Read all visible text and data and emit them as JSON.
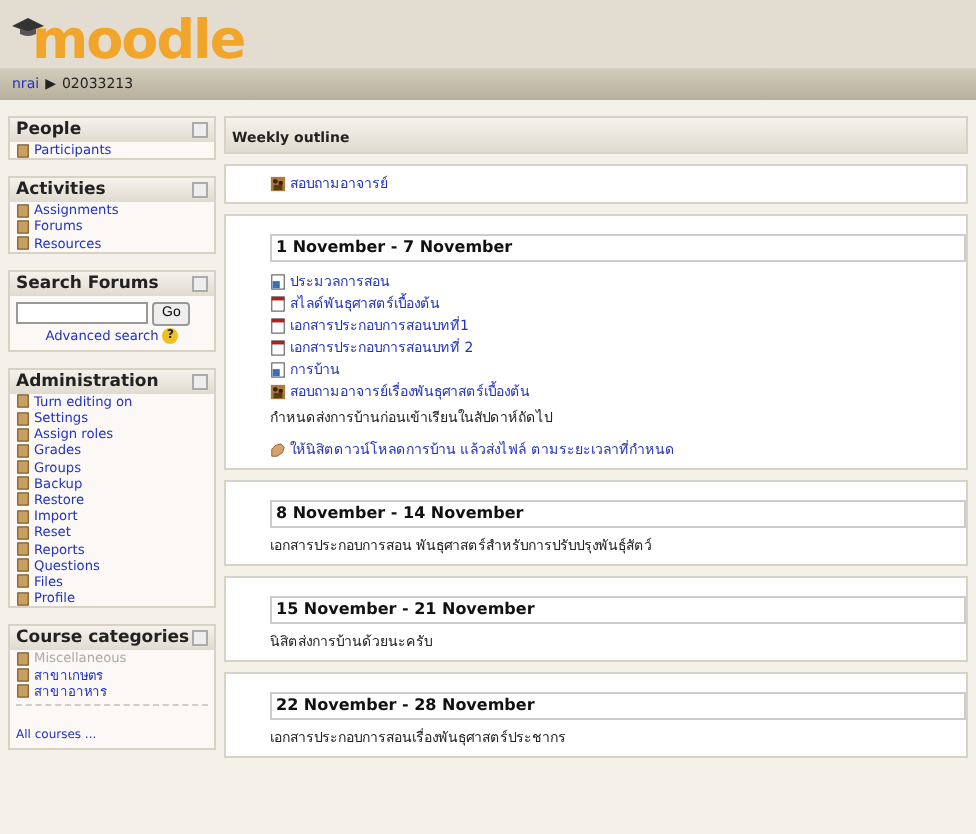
{
  "header": {
    "logo": "moodle"
  },
  "breadcrumb": [
    {
      "label": "nrai",
      "link": true
    },
    {
      "label": "▶",
      "link": false
    },
    {
      "label": "02033213",
      "link": false
    }
  ],
  "blocks": [
    {
      "kind": "links",
      "title": "People",
      "items": [
        {
          "label": "Participants",
          "dimmed": false
        }
      ]
    },
    {
      "kind": "links",
      "title": "Activities",
      "items": [
        {
          "label": "Assignments",
          "dimmed": false
        },
        {
          "label": "Forums",
          "dimmed": false
        },
        {
          "label": "Resources",
          "dimmed": false
        }
      ]
    },
    {
      "kind": "search",
      "title": "Search Forums",
      "button": "Go",
      "link": "Advanced search",
      "help": "?"
    },
    {
      "kind": "links",
      "title": "Administration",
      "items": [
        {
          "label": "Turn editing on",
          "dimmed": false
        },
        {
          "label": "Settings",
          "dimmed": false
        },
        {
          "label": "Assign roles",
          "dimmed": false
        },
        {
          "label": "Grades",
          "dimmed": false
        },
        {
          "label": "Groups",
          "dimmed": false
        },
        {
          "label": "Backup",
          "dimmed": false
        },
        {
          "label": "Restore",
          "dimmed": false
        },
        {
          "label": "Import",
          "dimmed": false
        },
        {
          "label": "Reset",
          "dimmed": false
        },
        {
          "label": "Reports",
          "dimmed": false
        },
        {
          "label": "Questions",
          "dimmed": false
        },
        {
          "label": "Files",
          "dimmed": false
        },
        {
          "label": "Profile",
          "dimmed": false
        }
      ]
    },
    {
      "kind": "links",
      "title": "Course categories",
      "items": [
        {
          "label": "Miscellaneous",
          "dimmed": true
        },
        {
          "label": "สาขาเกษตร",
          "dimmed": false
        },
        {
          "label": "สาขาอาหาร",
          "dimmed": false
        }
      ],
      "footer": "All courses ..."
    }
  ],
  "outline": {
    "title": "Weekly outline",
    "sections": [
      {
        "items": [
          {
            "kind": "forum",
            "text": "สอบถามอาจารย์"
          }
        ]
      },
      {
        "heading": "1 November - 7 November",
        "items": [
          {
            "kind": "doc",
            "text": "ประมวลการสอน"
          },
          {
            "kind": "pdf",
            "text": "สไลด์พันธุศาสตร์เบื้องต้น"
          },
          {
            "kind": "pdf",
            "text": "เอกสารประกอบการสอนบทที่1"
          },
          {
            "kind": "pdf",
            "text": "เอกสารประกอบการสอนบทที่ 2"
          },
          {
            "kind": "doc",
            "text": "การบ้าน"
          },
          {
            "kind": "forum",
            "text": "สอบถามอาจารย์เรื่องพันธุศาสตร์เบื้องต้น"
          },
          {
            "kind": "text",
            "text": "กำหนดส่งการบ้านก่อนเข้าเรียนในสัปดาห์ถัดไป"
          },
          {
            "kind": "assignment",
            "text": "ให้นิสิตดาวน์โหลดการบ้าน แล้วส่งไฟล์ ตามระยะเวลาที่กำหนด"
          }
        ]
      },
      {
        "heading": "8 November - 14 November",
        "items": [
          {
            "kind": "text",
            "text": "เอกสารประกอบการสอน พันธุศาสตร์สำหรับการปรับปรุงพันธุ์สัตว์"
          }
        ]
      },
      {
        "heading": "15 November - 21 November",
        "items": [
          {
            "kind": "text",
            "text": "นิสิตส่งการบ้านด้วยนะครับ"
          }
        ]
      },
      {
        "heading": "22 November - 28 November",
        "items": [
          {
            "kind": "text",
            "text": "เอกสารประกอบการสอนเรื่องพันธุศาสตร์ประชากร"
          }
        ]
      }
    ]
  }
}
